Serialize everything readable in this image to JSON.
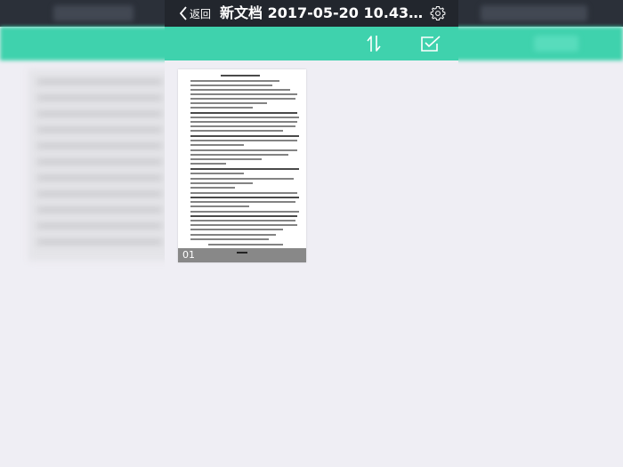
{
  "navbar": {
    "back_label": "返回",
    "title": "新文档 2017-05-20 10.43....",
    "back_icon": "chevron-left-icon",
    "settings_icon": "gear-icon"
  },
  "toolbar": {
    "sort_icon": "sort-arrows-icon",
    "confirm_icon": "checkbox-check-icon"
  },
  "pages": [
    {
      "index": "01"
    }
  ],
  "colors": {
    "navbar_bg": "#22262d",
    "toolbar_bg": "#3fd2ad",
    "page_bg": "#efeef4"
  }
}
